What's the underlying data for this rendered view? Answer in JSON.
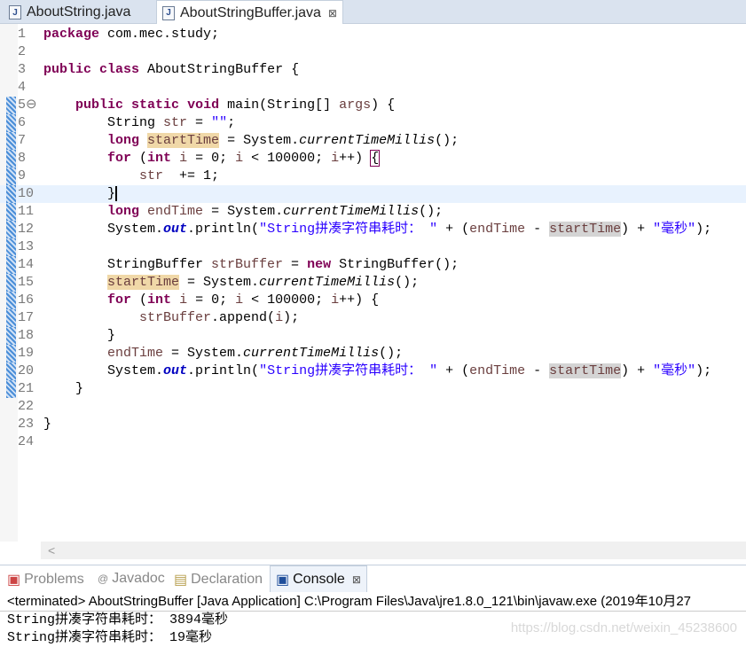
{
  "tabs": [
    {
      "label": "AboutString.java",
      "icon": "java-file-icon"
    },
    {
      "label": "AboutStringBuffer.java",
      "icon": "java-file-warning-icon",
      "close": "⊠"
    }
  ],
  "code": [
    [
      [
        "package",
        "k"
      ],
      [
        " com.mec.study;",
        "p"
      ]
    ],
    [],
    [
      [
        "public",
        "k"
      ],
      [
        " ",
        "p"
      ],
      [
        "class",
        "k"
      ],
      [
        " AboutStringBuffer {",
        "p"
      ]
    ],
    [],
    [
      [
        "    ",
        "p"
      ],
      [
        "public",
        "k"
      ],
      [
        " ",
        "p"
      ],
      [
        "static",
        "k"
      ],
      [
        " ",
        "p"
      ],
      [
        "void",
        "k"
      ],
      [
        " main(String[] ",
        "p"
      ],
      [
        "args",
        "v"
      ],
      [
        ") {",
        "p"
      ]
    ],
    [
      [
        "        String ",
        "p"
      ],
      [
        "str",
        "v"
      ],
      [
        " = ",
        "p"
      ],
      [
        "\"\"",
        "s"
      ],
      [
        ";",
        "p"
      ]
    ],
    [
      [
        "        ",
        "p"
      ],
      [
        "long",
        "k"
      ],
      [
        " ",
        "p"
      ],
      [
        "startTime",
        "vw"
      ],
      [
        " = System.",
        "p"
      ],
      [
        "currentTimeMillis",
        "m"
      ],
      [
        "();",
        "p"
      ]
    ],
    [
      [
        "        ",
        "p"
      ],
      [
        "for",
        "k"
      ],
      [
        " (",
        "p"
      ],
      [
        "int",
        "k"
      ],
      [
        " ",
        "p"
      ],
      [
        "i",
        "v"
      ],
      [
        " = 0; ",
        "p"
      ],
      [
        "i",
        "v"
      ],
      [
        " < 100000; ",
        "p"
      ],
      [
        "i",
        "v"
      ],
      [
        "++) ",
        "p"
      ],
      [
        "{",
        "b"
      ]
    ],
    [
      [
        "            ",
        "p"
      ],
      [
        "str",
        "v"
      ],
      [
        "  += 1;",
        "p"
      ]
    ],
    [
      [
        "        }",
        "caret"
      ]
    ],
    [
      [
        "        ",
        "p"
      ],
      [
        "long",
        "k"
      ],
      [
        " ",
        "p"
      ],
      [
        "endTime",
        "v"
      ],
      [
        " = System.",
        "p"
      ],
      [
        "currentTimeMillis",
        "m"
      ],
      [
        "();",
        "p"
      ]
    ],
    [
      [
        "        System.",
        "p"
      ],
      [
        "out",
        "f"
      ],
      [
        ".println(",
        "p"
      ],
      [
        "\"String拼凑字符串耗时： \"",
        "s"
      ],
      [
        " + (",
        "p"
      ],
      [
        "endTime",
        "v"
      ],
      [
        " - ",
        "p"
      ],
      [
        "startTime",
        "vr"
      ],
      [
        ") + ",
        "p"
      ],
      [
        "\"毫秒\"",
        "s"
      ],
      [
        ");",
        "p"
      ]
    ],
    [],
    [
      [
        "        StringBuffer ",
        "p"
      ],
      [
        "strBuffer",
        "v"
      ],
      [
        " = ",
        "p"
      ],
      [
        "new",
        "k"
      ],
      [
        " StringBuffer();",
        "p"
      ]
    ],
    [
      [
        "        ",
        "p"
      ],
      [
        "startTime",
        "vw"
      ],
      [
        " = System.",
        "p"
      ],
      [
        "currentTimeMillis",
        "m"
      ],
      [
        "();",
        "p"
      ]
    ],
    [
      [
        "        ",
        "p"
      ],
      [
        "for",
        "k"
      ],
      [
        " (",
        "p"
      ],
      [
        "int",
        "k"
      ],
      [
        " ",
        "p"
      ],
      [
        "i",
        "v"
      ],
      [
        " = 0; ",
        "p"
      ],
      [
        "i",
        "v"
      ],
      [
        " < 100000; ",
        "p"
      ],
      [
        "i",
        "v"
      ],
      [
        "++) {",
        "p"
      ]
    ],
    [
      [
        "            ",
        "p"
      ],
      [
        "strBuffer",
        "v"
      ],
      [
        ".append(",
        "p"
      ],
      [
        "i",
        "v"
      ],
      [
        ");",
        "p"
      ]
    ],
    [
      [
        "        }",
        "p"
      ]
    ],
    [
      [
        "        ",
        "p"
      ],
      [
        "endTime",
        "v"
      ],
      [
        " = System.",
        "p"
      ],
      [
        "currentTimeMillis",
        "m"
      ],
      [
        "();",
        "p"
      ]
    ],
    [
      [
        "        System.",
        "p"
      ],
      [
        "out",
        "f"
      ],
      [
        ".println(",
        "p"
      ],
      [
        "\"String拼凑字符串耗时： \"",
        "s"
      ],
      [
        " + (",
        "p"
      ],
      [
        "endTime",
        "v"
      ],
      [
        " - ",
        "p"
      ],
      [
        "startTime",
        "vr"
      ],
      [
        ") + ",
        "p"
      ],
      [
        "\"毫秒\"",
        "s"
      ],
      [
        ");",
        "p"
      ]
    ],
    [
      [
        "    }",
        "p"
      ]
    ],
    [],
    [
      [
        "}",
        "p"
      ]
    ],
    []
  ],
  "current_line": 10,
  "panel_tabs": [
    {
      "label": "Problems",
      "icon": "problems-icon"
    },
    {
      "label": "Javadoc",
      "icon": "@"
    },
    {
      "label": "Declaration",
      "icon": "declaration-icon"
    },
    {
      "label": "Console",
      "icon": "console-icon",
      "close": "⊠"
    }
  ],
  "console": {
    "header": "<terminated> AboutStringBuffer [Java Application] C:\\Program Files\\Java\\jre1.8.0_121\\bin\\javaw.exe (2019年10月27",
    "output": [
      "String拼凑字符串耗时： 3894毫秒",
      "String拼凑字符串耗时： 19毫秒"
    ]
  },
  "watermark": "https://blog.csdn.net/weixin_45238600",
  "scroll_left": "<"
}
